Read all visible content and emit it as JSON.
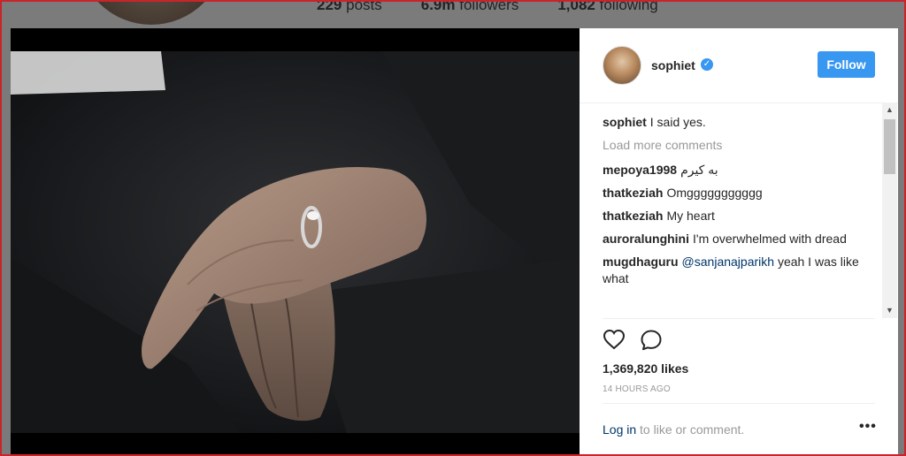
{
  "profile_bg": {
    "posts_count": "229",
    "posts_label": "posts",
    "followers_count": "6.9m",
    "followers_label": "followers",
    "following_count": "1,082",
    "following_label": "following"
  },
  "post": {
    "username": "sophiet",
    "verified": true,
    "follow_label": "Follow",
    "caption": "I said yes.",
    "load_more_label": "Load more comments",
    "comments": [
      {
        "user": "mepoya1998",
        "text": "به کیرم"
      },
      {
        "user": "thatkeziah",
        "text": "Omggggggggggg"
      },
      {
        "user": "thatkeziah",
        "text": "My heart"
      },
      {
        "user": "auroralunghini",
        "text": "I'm overwhelmed with dread"
      },
      {
        "user": "mugdhaguru",
        "mention": "@sanjanajparikh",
        "text": "yeah I was like what"
      }
    ],
    "likes": "1,369,820 likes",
    "time": "14 HOURS AGO",
    "login_link": "Log in",
    "login_text": "to like or comment.",
    "more_icon": "more-options-icon",
    "like_icon": "heart-icon",
    "comment_icon": "comment-bubble-icon"
  },
  "colors": {
    "accent": "#3897f0",
    "link": "#003569",
    "muted": "#999999"
  }
}
